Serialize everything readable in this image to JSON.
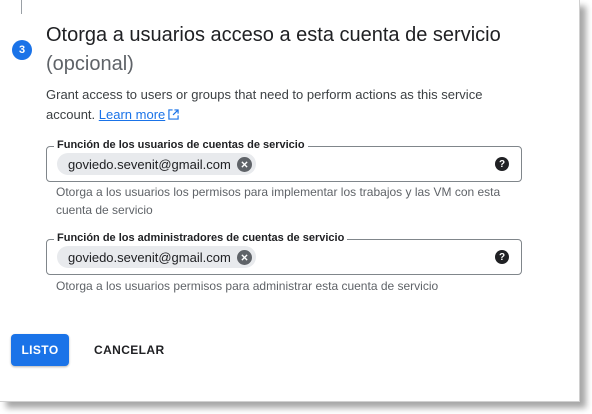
{
  "step": {
    "number": "3",
    "title": "Otorga a usuarios acceso a esta cuenta de servicio",
    "subtitle": "(opcional)",
    "description": "Grant access to users or groups that need to perform actions as this service account.",
    "learn_more": "Learn more"
  },
  "fields": [
    {
      "label": "Función de los usuarios de cuentas de servicio",
      "chip": "goviedo.sevenit@gmail.com",
      "hint": "Otorga a los usuarios los permisos para implementar los trabajos y las VM con esta cuenta de servicio"
    },
    {
      "label": "Función de los administradores de cuentas de servicio",
      "chip": "goviedo.sevenit@gmail.com",
      "hint": "Otorga a los usuarios permisos para administrar esta cuenta de servicio"
    }
  ],
  "buttons": {
    "done": "LISTO",
    "cancel": "CANCELAR"
  },
  "icons": {
    "step_badge": "step-number-badge",
    "external": "open-in-new-icon",
    "chip_remove": "remove-circle-icon",
    "help": "help-icon"
  },
  "colors": {
    "accent": "#1a73e8",
    "chip_bg": "#e8eaed"
  }
}
